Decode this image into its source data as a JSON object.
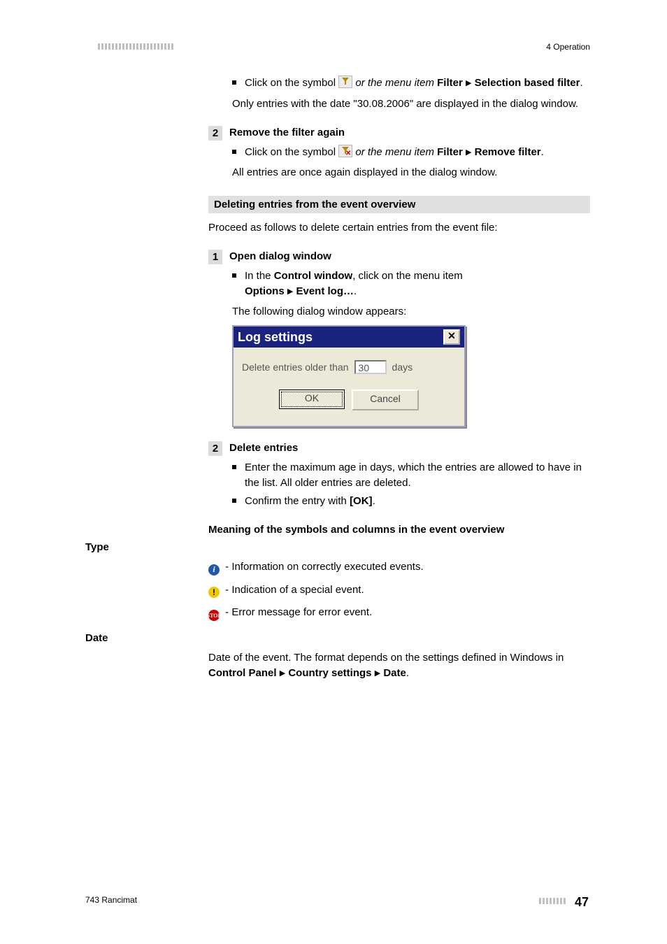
{
  "header": {
    "section": "4 Operation"
  },
  "intro_bullet": {
    "pre": "Click on the symbol ",
    "mid": "or the menu item ",
    "menu1": "Filter",
    "menu2": "Selection based filter",
    "result": "Only entries with the date \"30.08.2006\" are displayed in the dialog window."
  },
  "step2a": {
    "num": "2",
    "title": "Remove the filter again",
    "bullet_pre": "Click on the symbol ",
    "bullet_mid": "or the menu item ",
    "menu1": "Filter",
    "menu2": "Remove filter",
    "result": "All entries are once again displayed in the dialog window."
  },
  "delete_section": {
    "title": "Deleting entries from the event overview",
    "intro": "Proceed as follows to delete certain entries from the event file:"
  },
  "step1b": {
    "num": "1",
    "title": "Open dialog window",
    "bullet_pre": "In the ",
    "cw": "Control window",
    "bullet_post": ", click on the menu item",
    "menu1": "Options",
    "menu2": "Event log…",
    "result": "The following dialog window appears:"
  },
  "dialog": {
    "title": "Log settings",
    "label": "Delete entries older than",
    "value": "30",
    "unit": "days",
    "ok": "OK",
    "cancel": "Cancel"
  },
  "step2b": {
    "num": "2",
    "title": "Delete entries",
    "b1": "Enter the maximum age in days, which the entries are allowed to have in the list. All older entries are deleted.",
    "b2_pre": "Confirm the entry with ",
    "b2_btn": "[OK]"
  },
  "meaning": {
    "title": "Meaning of the symbols and columns in the event overview"
  },
  "type": {
    "label": "Type",
    "info": " - Information on correctly executed events.",
    "warn": " - Indication of a special event.",
    "err": " - Error message for error event."
  },
  "date": {
    "label": "Date",
    "text_pre": "Date of the event. The format depends on the settings defined in Windows in ",
    "p1": "Control Panel",
    "p2": "Country settings",
    "p3": "Date"
  },
  "footer": {
    "left": "743 Rancimat",
    "page": "47"
  }
}
